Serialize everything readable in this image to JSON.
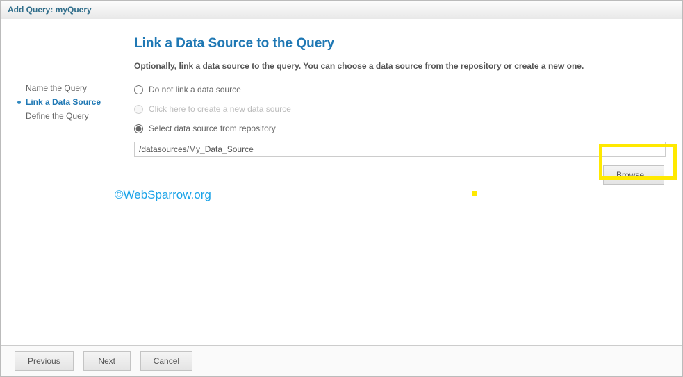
{
  "header": {
    "title": "Add Query: myQuery"
  },
  "sidebar": {
    "items": [
      {
        "label": "Name the Query"
      },
      {
        "label": "Link a Data Source"
      },
      {
        "label": "Define the Query"
      }
    ]
  },
  "main": {
    "title": "Link a Data Source to the Query",
    "subtitle": "Optionally, link a data source to the query. You can choose a data source from the repository or create a new one.",
    "options": {
      "none": "Do not link a data source",
      "create": "Click here to create a new data source",
      "repo": "Select data source from repository"
    },
    "repo_path": "/datasources/My_Data_Source",
    "browse_label": "Browse..."
  },
  "footer": {
    "previous": "Previous",
    "next": "Next",
    "cancel": "Cancel"
  },
  "watermark": "©WebSparrow.org"
}
